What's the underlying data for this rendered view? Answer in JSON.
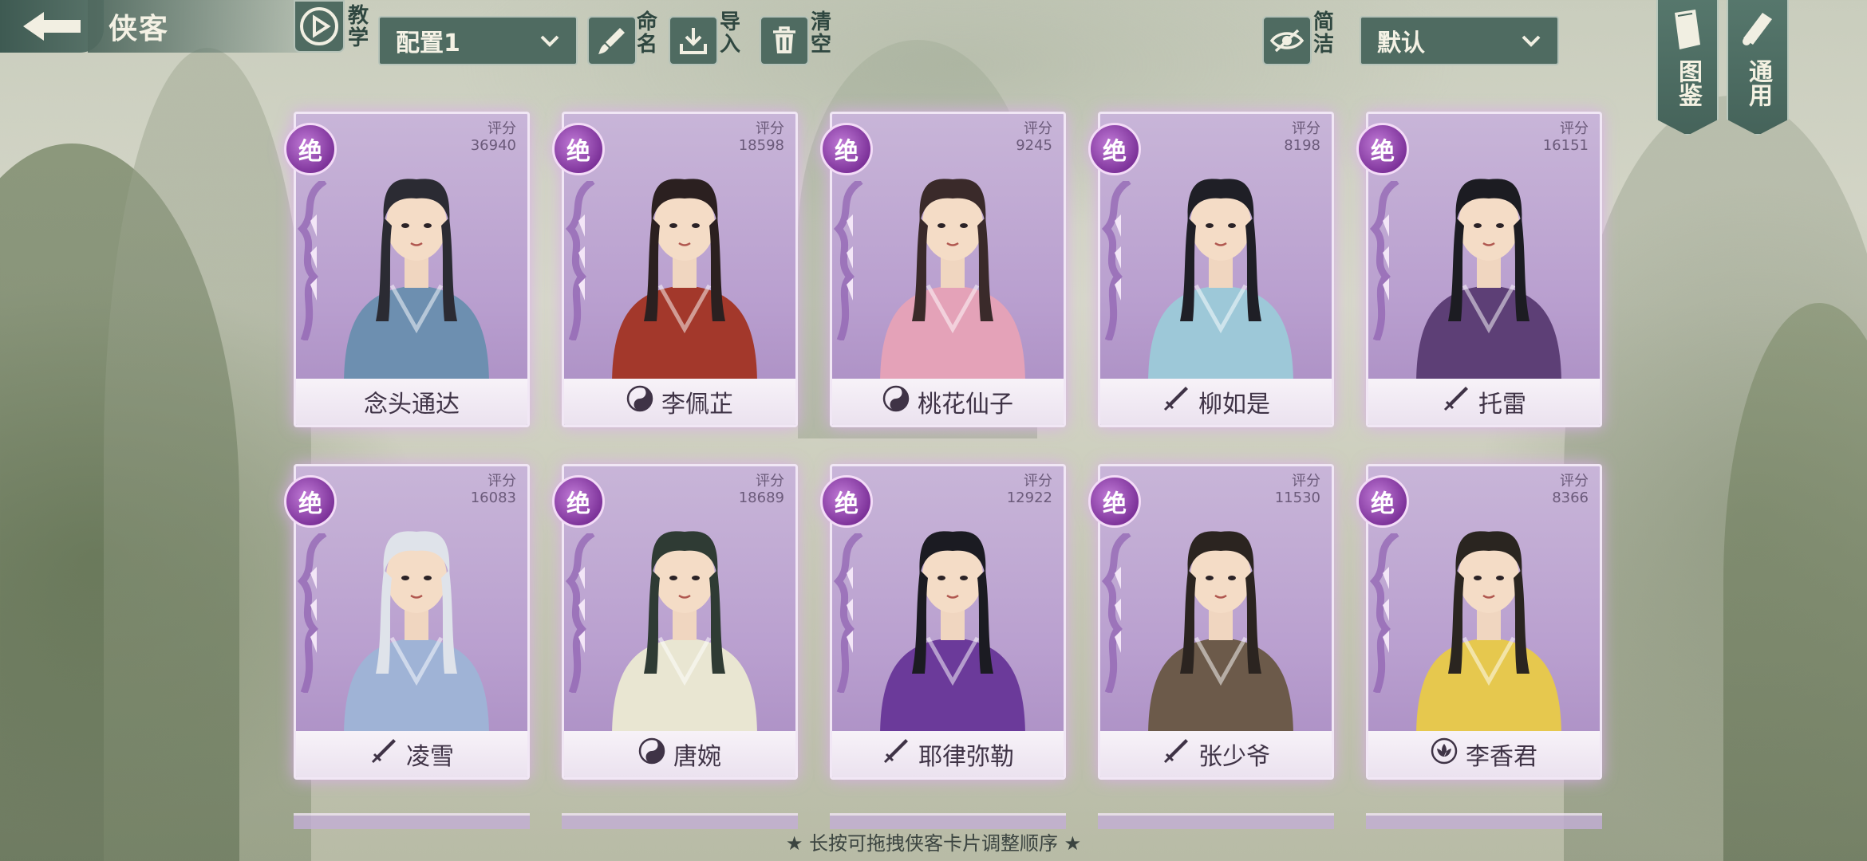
{
  "header": {
    "title": "侠客",
    "tutorial_label": "教学",
    "config_select": "配置1",
    "rename_label": "命名",
    "import_label": "导入",
    "clear_label": "清空",
    "simple_label": "简洁",
    "sort_select": "默认",
    "codex_label": "图鉴",
    "general_label": "通用"
  },
  "score_label": "评分",
  "grade_label": "绝",
  "cards": [
    {
      "name": "念头通达",
      "score": "36940",
      "faction_icon": "none",
      "colors": [
        "#6d8fb0",
        "#2b2b33"
      ]
    },
    {
      "name": "李佩芷",
      "score": "18598",
      "faction_icon": "taiji-icon",
      "colors": [
        "#a3382b",
        "#2b2020"
      ]
    },
    {
      "name": "桃花仙子",
      "score": "9245",
      "faction_icon": "taiji-icon",
      "colors": [
        "#e4a2b8",
        "#3a2a2a"
      ]
    },
    {
      "name": "柳如是",
      "score": "8198",
      "faction_icon": "sword-icon",
      "colors": [
        "#9dc8d8",
        "#1f1f26"
      ]
    },
    {
      "name": "托雷",
      "score": "16151",
      "faction_icon": "sword-icon",
      "colors": [
        "#5d3f76",
        "#1c1c22"
      ]
    },
    {
      "name": "凌雪",
      "score": "16083",
      "faction_icon": "sword-icon",
      "colors": [
        "#9fb3d6",
        "#dfe3ea"
      ]
    },
    {
      "name": "唐婉",
      "score": "18689",
      "faction_icon": "taiji-icon",
      "colors": [
        "#e9e6d2",
        "#2f3b34"
      ]
    },
    {
      "name": "耶律弥勒",
      "score": "12922",
      "faction_icon": "sword-icon",
      "colors": [
        "#6b3a9a",
        "#1b1b22"
      ]
    },
    {
      "name": "张少爷",
      "score": "11530",
      "faction_icon": "sword-icon",
      "colors": [
        "#6c5a4a",
        "#2b2420"
      ]
    },
    {
      "name": "李香君",
      "score": "8366",
      "faction_icon": "lotus-icon",
      "colors": [
        "#e6c84e",
        "#2a2520"
      ]
    }
  ],
  "hint": "★ 长按可拖拽侠客卡片调整顺序 ★"
}
